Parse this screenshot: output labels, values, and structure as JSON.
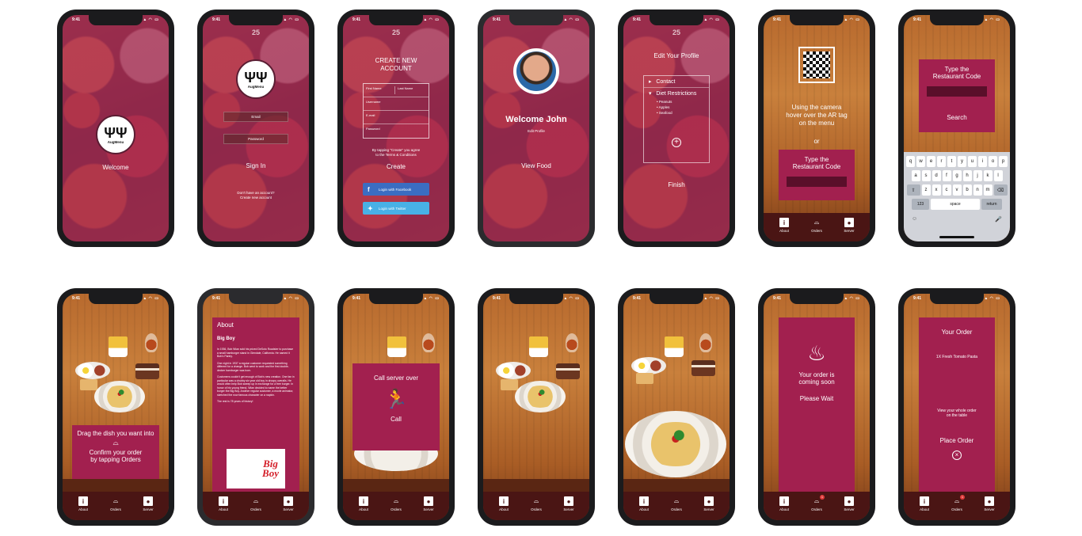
{
  "status": {
    "time": "9:41",
    "signal": "▴ ◠ ▭"
  },
  "brand": {
    "logo_text": "AugMenu",
    "top_mark": "25"
  },
  "tabs": {
    "about": "About",
    "orders": "Orders",
    "server": "Server",
    "order_badge": "1"
  },
  "screens": {
    "welcome": {
      "label": "Welcome"
    },
    "signin": {
      "email": "Email",
      "password": "Password",
      "label": "Sign In",
      "no_account": "Don't have an account?",
      "create": "Create new account"
    },
    "create": {
      "title_1": "CREATE NEW",
      "title_2": "ACCOUNT",
      "first_name": "First Name",
      "last_name": "Last Name",
      "username": "Username",
      "email": "E-mail",
      "password": "Password",
      "terms_1": "By tapping \"Create\" you agree",
      "terms_2": "to the Terms & Conditions",
      "label": "Create",
      "facebook": "Login with Facebook",
      "twitter": "Login with Twitter"
    },
    "profile_welcome": {
      "greeting": "Welcome John",
      "edit": "Edit Profile",
      "view_food": "View Food"
    },
    "edit_profile": {
      "title": "Edit Your Profile",
      "contact": "Contact",
      "diet": "Diet Restrictions",
      "items": [
        "• Peanuts",
        "• Apples",
        "• Seafood"
      ],
      "finish": "Finish"
    },
    "scan": {
      "line_1": "Using the camera",
      "line_2": "hover over the AR tag",
      "line_3": "on the menu",
      "or": "or",
      "code_1": "Type the",
      "code_2": "Restaurant Code"
    },
    "code_entry": {
      "code_1": "Type the",
      "code_2": "Restaurant Code",
      "search": "Search"
    },
    "drag": {
      "line_1": "Drag the dish you want into",
      "line_2": "Confirm your order",
      "line_3": "by tapping Orders"
    },
    "about": {
      "title": "About",
      "restaurant": "Big Boy",
      "p1": "In 1936, Bob Wian sold his prized DeSoto Roadster to purchase a small hamburger stand in Glendale, California. He named it Bob's Pantry.",
      "p2": "One night in 1937 a regular customer requested something different for a change. Bob went to work and the first double-decker hamburger was born.",
      "p3": "Customers couldn't get enough of Bob's new creation. One fan in particular was a chubby six year old boy in droopy overalls. He would often help Bob sweep up in exchange for a free burger. In honor of his young friend, Wian decided to name the better burger the Big Boy. Another regular customer, a movie animator, sketched the now famous character on a napkin.",
      "p4": "The rest is 78 years of history!",
      "logo_1": "Big",
      "logo_2": "Boy"
    },
    "call": {
      "line_1": "Call server over",
      "label": "Call"
    },
    "coming": {
      "line_1": "Your order is",
      "line_2": "coming soon",
      "wait": "Please Wait"
    },
    "your_order": {
      "title": "Your Order",
      "item": "1X Fresh Tomato Pasta",
      "view_1": "View your whole order",
      "view_2": "on the table",
      "place": "Place Order"
    }
  },
  "keyboard": {
    "row1": [
      "q",
      "w",
      "e",
      "r",
      "t",
      "y",
      "u",
      "i",
      "o",
      "p"
    ],
    "row2": [
      "a",
      "s",
      "d",
      "f",
      "g",
      "h",
      "j",
      "k",
      "l"
    ],
    "row3": [
      "z",
      "x",
      "c",
      "v",
      "b",
      "n",
      "m"
    ],
    "num": "123",
    "space": "space",
    "return": "return"
  },
  "colors": {
    "brand": "#a2204f",
    "tabbar": "#4a1514"
  }
}
